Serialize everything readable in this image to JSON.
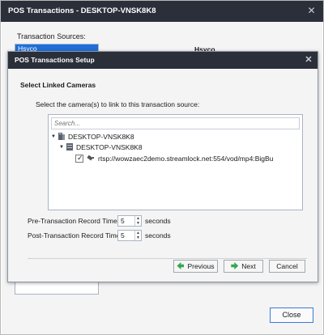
{
  "outer": {
    "title": "POS Transactions - DESKTOP-VNSK8K8",
    "sources_label": "Transaction Sources:",
    "sources": [
      "Hsyco"
    ],
    "selected_source": "Hsyco",
    "close_label": "Close"
  },
  "dialog": {
    "title": "POS Transactions Setup",
    "section_title": "Select Linked Cameras",
    "instruction": "Select the camera(s) to link to this transaction source:",
    "search_placeholder": "Search...",
    "tree": {
      "server": "DESKTOP-VNSK8K8",
      "recorder": "DESKTOP-VNSK8K8",
      "camera": "rtsp://wowzaec2demo.streamlock.net:554/vod/mp4:BigBu",
      "camera_checked": true
    },
    "pre_label": "Pre-Transaction Record Time:",
    "pre_value": "5",
    "post_label": "Post-Transaction Record Time:",
    "post_value": "5",
    "unit": "seconds",
    "previous_label": "Previous",
    "next_label": "Next",
    "cancel_label": "Cancel"
  },
  "colors": {
    "titlebar": "#2a2f3a",
    "selection": "#1e6fd9",
    "arrow_green": "#34a853"
  },
  "icons": [
    "close-icon",
    "expand-arrow-icon",
    "server-icon",
    "recorder-icon",
    "checkbox-icon",
    "camera-icon",
    "previous-arrow-icon",
    "next-arrow-icon"
  ]
}
